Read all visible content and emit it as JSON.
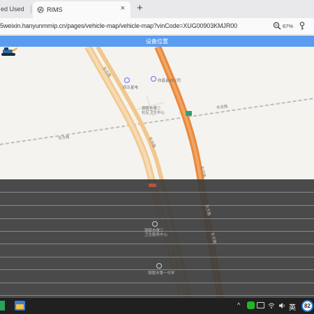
{
  "browser": {
    "inactive_tab_label": "ed Used",
    "active_tab_title": "RIMS",
    "close_symbol": "×",
    "new_tab_symbol": "+",
    "url": "5weixin.hanyunmmip.cn/pages/vehicle-map/vehicle-map?vinCode=XUG00903KMJR00",
    "zoom_label": "67%"
  },
  "page": {
    "header_title": "设备位置",
    "header_color": "#5a9cf0"
  },
  "map": {
    "labels": {
      "station_1": "四五星电",
      "station_2": "向昌金洲公司",
      "compound": "铜陵市第三\n社区卫生中心",
      "road_1": "东北路",
      "road_2": "东方路",
      "road_3": "东龙路",
      "road_4": "东方路",
      "road_5": "东环路",
      "lower_poi_1": "铜陵市第三\n卫生服务中心",
      "lower_poi_2": "铜陵市第一中学",
      "road_6": "东方路",
      "road_7": "东方路"
    },
    "icons": {
      "vehicle": "excavator-icon",
      "poi": "poi-ring-icon",
      "highway_sign": "highway-shield-icon"
    }
  },
  "taskbar": {
    "tray_up_arrow": "^",
    "tray_sound": "🔊",
    "ime_label": "英",
    "badge_number": "82"
  }
}
